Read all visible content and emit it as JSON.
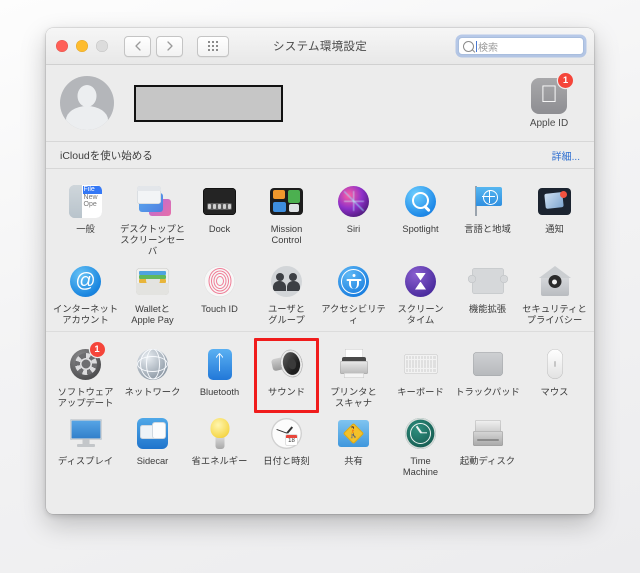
{
  "window": {
    "title": "システム環境設定",
    "traffic": {
      "close": "close-button",
      "minimize": "minimize-button",
      "zoom": "zoom-button"
    },
    "nav": {
      "back": "‹",
      "forward": "›",
      "show_all": "show-all-grid-button"
    },
    "search": {
      "placeholder": "検索",
      "value": ""
    }
  },
  "account": {
    "name_redacted": "",
    "apple_id": {
      "label": "Apple ID",
      "badge": "1"
    }
  },
  "icloud": {
    "text": "iCloudを使い始める",
    "more_label": "詳細..."
  },
  "sections": [
    {
      "name": "personal",
      "rows": [
        [
          {
            "label": "一般",
            "icon": "general-icon",
            "badge": null,
            "selected": false
          },
          {
            "label": "デスクトップと\nスクリーンセーバ",
            "icon": "desktop-screensaver-icon",
            "badge": null,
            "selected": false
          },
          {
            "label": "Dock",
            "icon": "dock-icon",
            "badge": null,
            "selected": false
          },
          {
            "label": "Mission\nControl",
            "icon": "mission-control-icon",
            "badge": null,
            "selected": false
          },
          {
            "label": "Siri",
            "icon": "siri-icon",
            "badge": null,
            "selected": false
          },
          {
            "label": "Spotlight",
            "icon": "spotlight-icon",
            "badge": null,
            "selected": false
          },
          {
            "label": "言語と地域",
            "icon": "language-region-icon",
            "badge": null,
            "selected": false
          },
          {
            "label": "通知",
            "icon": "notifications-icon",
            "badge": null,
            "selected": false
          }
        ],
        [
          {
            "label": "インターネット\nアカウント",
            "icon": "internet-accounts-icon",
            "badge": null,
            "selected": false
          },
          {
            "label": "Walletと\nApple Pay",
            "icon": "wallet-apple-pay-icon",
            "badge": null,
            "selected": false
          },
          {
            "label": "Touch ID",
            "icon": "touch-id-icon",
            "badge": null,
            "selected": false
          },
          {
            "label": "ユーザと\nグループ",
            "icon": "users-groups-icon",
            "badge": null,
            "selected": false
          },
          {
            "label": "アクセシビリティ",
            "icon": "accessibility-icon",
            "badge": null,
            "selected": false
          },
          {
            "label": "スクリーン\nタイム",
            "icon": "screen-time-icon",
            "badge": null,
            "selected": false
          },
          {
            "label": "機能拡張",
            "icon": "extensions-icon",
            "badge": null,
            "selected": false
          },
          {
            "label": "セキュリティと\nプライバシー",
            "icon": "security-privacy-icon",
            "badge": null,
            "selected": false
          }
        ]
      ]
    },
    {
      "name": "hardware",
      "rows": [
        [
          {
            "label": "ソフトウェア\nアップデート",
            "icon": "software-update-icon",
            "badge": "1",
            "selected": false
          },
          {
            "label": "ネットワーク",
            "icon": "network-icon",
            "badge": null,
            "selected": false
          },
          {
            "label": "Bluetooth",
            "icon": "bluetooth-icon",
            "badge": null,
            "selected": false
          },
          {
            "label": "サウンド",
            "icon": "sound-icon",
            "badge": null,
            "selected": true
          },
          {
            "label": "プリンタと\nスキャナ",
            "icon": "printers-scanners-icon",
            "badge": null,
            "selected": false
          },
          {
            "label": "キーボード",
            "icon": "keyboard-icon",
            "badge": null,
            "selected": false
          },
          {
            "label": "トラックパッド",
            "icon": "trackpad-icon",
            "badge": null,
            "selected": false
          },
          {
            "label": "マウス",
            "icon": "mouse-icon",
            "badge": null,
            "selected": false
          }
        ],
        [
          {
            "label": "ディスプレイ",
            "icon": "displays-icon",
            "badge": null,
            "selected": false
          },
          {
            "label": "Sidecar",
            "icon": "sidecar-icon",
            "badge": null,
            "selected": false
          },
          {
            "label": "省エネルギー",
            "icon": "energy-saver-icon",
            "badge": null,
            "selected": false
          },
          {
            "label": "日付と時刻",
            "icon": "date-time-icon",
            "badge": null,
            "selected": false
          },
          {
            "label": "共有",
            "icon": "sharing-icon",
            "badge": null,
            "selected": false
          },
          {
            "label": "Time\nMachine",
            "icon": "time-machine-icon",
            "badge": null,
            "selected": false
          },
          {
            "label": "起動ディスク",
            "icon": "startup-disk-icon",
            "badge": null,
            "selected": false
          }
        ]
      ]
    }
  ],
  "colors": {
    "highlight": "#f01c1c",
    "badge": "#f5453a",
    "link": "#2f6fd0",
    "window_bg": "#ececec"
  }
}
